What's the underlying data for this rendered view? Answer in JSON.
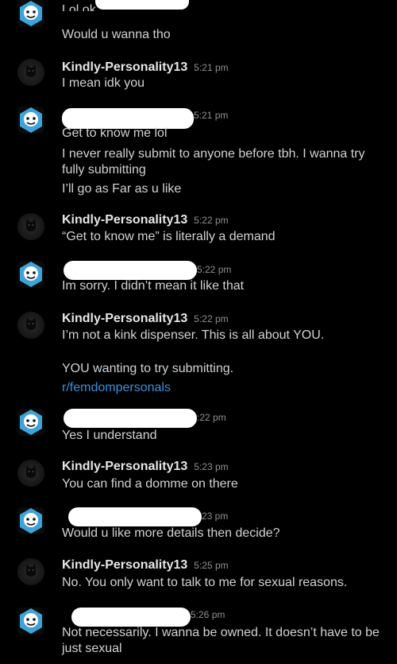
{
  "colors": {
    "background": "#000000",
    "text": "#d0d3d5",
    "username": "#e8e8e8",
    "timestamp": "#8e9093",
    "link": "#3a8fd9",
    "redaction": "#ffffff"
  },
  "messages": [
    {
      "user": "",
      "time": "",
      "lines": [
        "Lol ok",
        "Would u wanna tho"
      ]
    },
    {
      "user": "Kindly-Personality13",
      "time": "5:21 pm",
      "lines": [
        "I mean idk you"
      ]
    },
    {
      "user": "",
      "time": "5:21 pm",
      "lines": [
        "Get to know me lol",
        "I never really submit to anyone before tbh. I wanna try fully submitting",
        "I’ll go as Far as u like"
      ]
    },
    {
      "user": "Kindly-Personality13",
      "time": "5:22 pm",
      "lines": [
        "“Get to know me” is literally a demand"
      ]
    },
    {
      "user": "",
      "time": "5:22 pm",
      "lines": [
        "Im sorry. I didn’t mean it like that"
      ]
    },
    {
      "user": "Kindly-Personality13",
      "time": "5:22 pm",
      "lines": [
        "I’m not a kink dispenser. This is all about YOU.",
        "YOU wanting to try submitting."
      ],
      "link": "r/femdompersonals"
    },
    {
      "user": "",
      "time": ":22 pm",
      "lines": [
        "Yes I understand"
      ]
    },
    {
      "user": "Kindly-Personality13",
      "time": "5:23 pm",
      "lines": [
        "You can find a domme on there"
      ]
    },
    {
      "user": "",
      "time": "23 pm",
      "lines": [
        "Would u like more details then decide?"
      ]
    },
    {
      "user": "Kindly-Personality13",
      "time": "5:25 pm",
      "lines": [
        "No. You only want to talk to me for sexual reasons."
      ]
    },
    {
      "user": "",
      "time": "5:26 pm",
      "lines": [
        "Not necessarily. I wanna be owned. It doesn’t have to be just sexual"
      ]
    }
  ]
}
